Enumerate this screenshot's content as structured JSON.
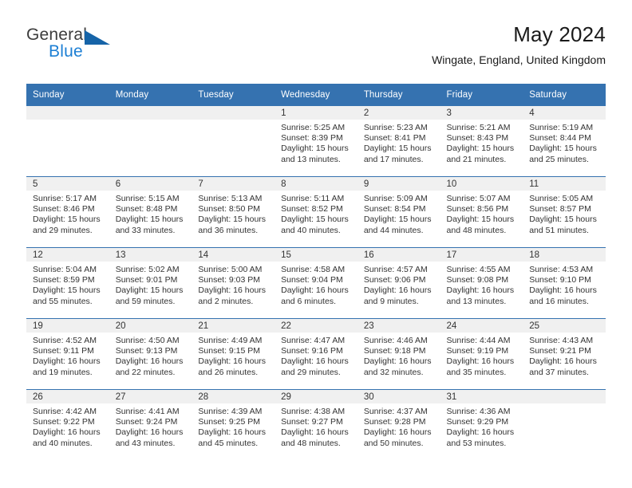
{
  "brand": {
    "name_part1": "General",
    "name_part2": "Blue",
    "triangle_color": "#1664a8",
    "blue_color": "#1c7fd4"
  },
  "header": {
    "title": "May 2024",
    "subtitle": "Wingate, England, United Kingdom",
    "accent_color": "#3572b0",
    "daynum_band_color": "#f0f0f0"
  },
  "weekdays": [
    "Sunday",
    "Monday",
    "Tuesday",
    "Wednesday",
    "Thursday",
    "Friday",
    "Saturday"
  ],
  "weeks": [
    [
      {
        "day": "",
        "sunrise": "",
        "sunset": "",
        "daylight1": "",
        "daylight2": ""
      },
      {
        "day": "",
        "sunrise": "",
        "sunset": "",
        "daylight1": "",
        "daylight2": ""
      },
      {
        "day": "",
        "sunrise": "",
        "sunset": "",
        "daylight1": "",
        "daylight2": ""
      },
      {
        "day": "1",
        "sunrise": "Sunrise: 5:25 AM",
        "sunset": "Sunset: 8:39 PM",
        "daylight1": "Daylight: 15 hours",
        "daylight2": "and 13 minutes."
      },
      {
        "day": "2",
        "sunrise": "Sunrise: 5:23 AM",
        "sunset": "Sunset: 8:41 PM",
        "daylight1": "Daylight: 15 hours",
        "daylight2": "and 17 minutes."
      },
      {
        "day": "3",
        "sunrise": "Sunrise: 5:21 AM",
        "sunset": "Sunset: 8:43 PM",
        "daylight1": "Daylight: 15 hours",
        "daylight2": "and 21 minutes."
      },
      {
        "day": "4",
        "sunrise": "Sunrise: 5:19 AM",
        "sunset": "Sunset: 8:44 PM",
        "daylight1": "Daylight: 15 hours",
        "daylight2": "and 25 minutes."
      }
    ],
    [
      {
        "day": "5",
        "sunrise": "Sunrise: 5:17 AM",
        "sunset": "Sunset: 8:46 PM",
        "daylight1": "Daylight: 15 hours",
        "daylight2": "and 29 minutes."
      },
      {
        "day": "6",
        "sunrise": "Sunrise: 5:15 AM",
        "sunset": "Sunset: 8:48 PM",
        "daylight1": "Daylight: 15 hours",
        "daylight2": "and 33 minutes."
      },
      {
        "day": "7",
        "sunrise": "Sunrise: 5:13 AM",
        "sunset": "Sunset: 8:50 PM",
        "daylight1": "Daylight: 15 hours",
        "daylight2": "and 36 minutes."
      },
      {
        "day": "8",
        "sunrise": "Sunrise: 5:11 AM",
        "sunset": "Sunset: 8:52 PM",
        "daylight1": "Daylight: 15 hours",
        "daylight2": "and 40 minutes."
      },
      {
        "day": "9",
        "sunrise": "Sunrise: 5:09 AM",
        "sunset": "Sunset: 8:54 PM",
        "daylight1": "Daylight: 15 hours",
        "daylight2": "and 44 minutes."
      },
      {
        "day": "10",
        "sunrise": "Sunrise: 5:07 AM",
        "sunset": "Sunset: 8:56 PM",
        "daylight1": "Daylight: 15 hours",
        "daylight2": "and 48 minutes."
      },
      {
        "day": "11",
        "sunrise": "Sunrise: 5:05 AM",
        "sunset": "Sunset: 8:57 PM",
        "daylight1": "Daylight: 15 hours",
        "daylight2": "and 51 minutes."
      }
    ],
    [
      {
        "day": "12",
        "sunrise": "Sunrise: 5:04 AM",
        "sunset": "Sunset: 8:59 PM",
        "daylight1": "Daylight: 15 hours",
        "daylight2": "and 55 minutes."
      },
      {
        "day": "13",
        "sunrise": "Sunrise: 5:02 AM",
        "sunset": "Sunset: 9:01 PM",
        "daylight1": "Daylight: 15 hours",
        "daylight2": "and 59 minutes."
      },
      {
        "day": "14",
        "sunrise": "Sunrise: 5:00 AM",
        "sunset": "Sunset: 9:03 PM",
        "daylight1": "Daylight: 16 hours",
        "daylight2": "and 2 minutes."
      },
      {
        "day": "15",
        "sunrise": "Sunrise: 4:58 AM",
        "sunset": "Sunset: 9:04 PM",
        "daylight1": "Daylight: 16 hours",
        "daylight2": "and 6 minutes."
      },
      {
        "day": "16",
        "sunrise": "Sunrise: 4:57 AM",
        "sunset": "Sunset: 9:06 PM",
        "daylight1": "Daylight: 16 hours",
        "daylight2": "and 9 minutes."
      },
      {
        "day": "17",
        "sunrise": "Sunrise: 4:55 AM",
        "sunset": "Sunset: 9:08 PM",
        "daylight1": "Daylight: 16 hours",
        "daylight2": "and 13 minutes."
      },
      {
        "day": "18",
        "sunrise": "Sunrise: 4:53 AM",
        "sunset": "Sunset: 9:10 PM",
        "daylight1": "Daylight: 16 hours",
        "daylight2": "and 16 minutes."
      }
    ],
    [
      {
        "day": "19",
        "sunrise": "Sunrise: 4:52 AM",
        "sunset": "Sunset: 9:11 PM",
        "daylight1": "Daylight: 16 hours",
        "daylight2": "and 19 minutes."
      },
      {
        "day": "20",
        "sunrise": "Sunrise: 4:50 AM",
        "sunset": "Sunset: 9:13 PM",
        "daylight1": "Daylight: 16 hours",
        "daylight2": "and 22 minutes."
      },
      {
        "day": "21",
        "sunrise": "Sunrise: 4:49 AM",
        "sunset": "Sunset: 9:15 PM",
        "daylight1": "Daylight: 16 hours",
        "daylight2": "and 26 minutes."
      },
      {
        "day": "22",
        "sunrise": "Sunrise: 4:47 AM",
        "sunset": "Sunset: 9:16 PM",
        "daylight1": "Daylight: 16 hours",
        "daylight2": "and 29 minutes."
      },
      {
        "day": "23",
        "sunrise": "Sunrise: 4:46 AM",
        "sunset": "Sunset: 9:18 PM",
        "daylight1": "Daylight: 16 hours",
        "daylight2": "and 32 minutes."
      },
      {
        "day": "24",
        "sunrise": "Sunrise: 4:44 AM",
        "sunset": "Sunset: 9:19 PM",
        "daylight1": "Daylight: 16 hours",
        "daylight2": "and 35 minutes."
      },
      {
        "day": "25",
        "sunrise": "Sunrise: 4:43 AM",
        "sunset": "Sunset: 9:21 PM",
        "daylight1": "Daylight: 16 hours",
        "daylight2": "and 37 minutes."
      }
    ],
    [
      {
        "day": "26",
        "sunrise": "Sunrise: 4:42 AM",
        "sunset": "Sunset: 9:22 PM",
        "daylight1": "Daylight: 16 hours",
        "daylight2": "and 40 minutes."
      },
      {
        "day": "27",
        "sunrise": "Sunrise: 4:41 AM",
        "sunset": "Sunset: 9:24 PM",
        "daylight1": "Daylight: 16 hours",
        "daylight2": "and 43 minutes."
      },
      {
        "day": "28",
        "sunrise": "Sunrise: 4:39 AM",
        "sunset": "Sunset: 9:25 PM",
        "daylight1": "Daylight: 16 hours",
        "daylight2": "and 45 minutes."
      },
      {
        "day": "29",
        "sunrise": "Sunrise: 4:38 AM",
        "sunset": "Sunset: 9:27 PM",
        "daylight1": "Daylight: 16 hours",
        "daylight2": "and 48 minutes."
      },
      {
        "day": "30",
        "sunrise": "Sunrise: 4:37 AM",
        "sunset": "Sunset: 9:28 PM",
        "daylight1": "Daylight: 16 hours",
        "daylight2": "and 50 minutes."
      },
      {
        "day": "31",
        "sunrise": "Sunrise: 4:36 AM",
        "sunset": "Sunset: 9:29 PM",
        "daylight1": "Daylight: 16 hours",
        "daylight2": "and 53 minutes."
      },
      {
        "day": "",
        "sunrise": "",
        "sunset": "",
        "daylight1": "",
        "daylight2": ""
      }
    ]
  ]
}
